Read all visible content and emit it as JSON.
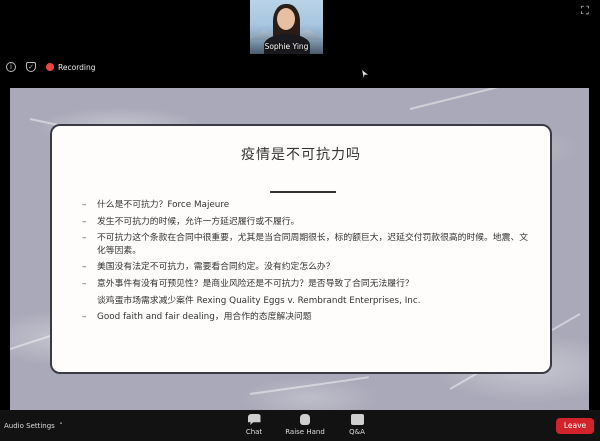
{
  "participant": {
    "name": "Sophie Ying"
  },
  "info_bar": {
    "recording_label": "Recording"
  },
  "slide": {
    "title": "疫情是不可抗力吗",
    "bullets": [
      "什么是不可抗力？Force Majeure",
      "发生不可抗力的时候，允许一方延迟履行或不履行。",
      "不可抗力这个条款在合同中很重要，尤其是当合同周期很长，标的额巨大，迟延交付罚款很高的时候。地震、文化等因素。",
      "美国没有法定不可抗力，需要看合同约定。没有约定怎么办？",
      "意外事件有没有可预见性？是商业风险还是不可抗力？是否导致了合同无法履行？",
      "Good faith and fair dealing，用合作的态度解决问题"
    ],
    "subline": "谈鸡蛋市场需求减少案件 Rexing Quality Eggs v. Rembrandt Enterprises, Inc."
  },
  "toolbar": {
    "audio_settings_label": "Audio Settings",
    "chat_label": "Chat",
    "raise_hand_label": "Raise Hand",
    "qa_label": "Q&A",
    "leave_label": "Leave"
  },
  "colors": {
    "leave": "#d2232a",
    "recording_dot": "#e8493f",
    "slide_bg": "#a9a9b9"
  }
}
